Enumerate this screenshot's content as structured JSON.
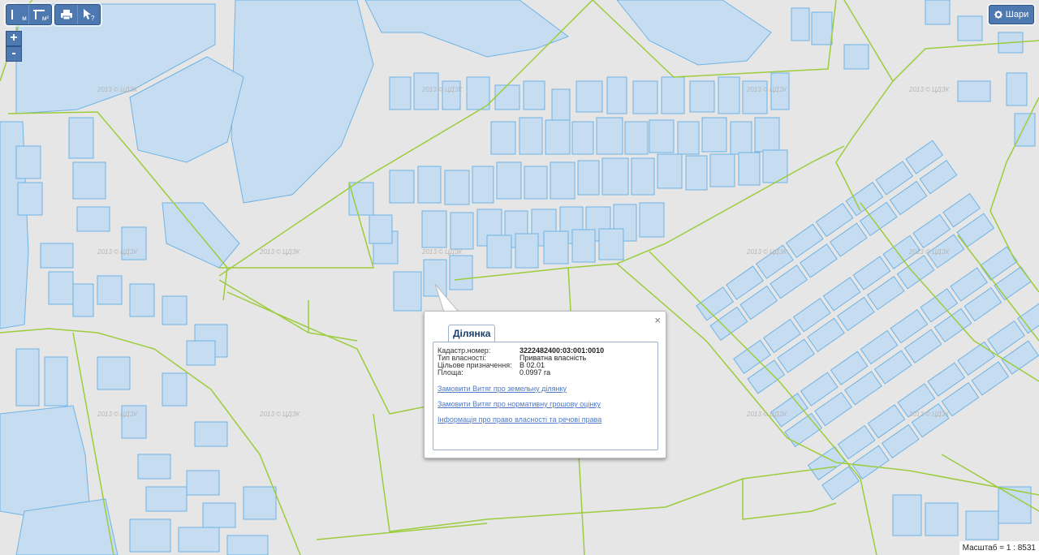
{
  "toolbar": {
    "measure_length_label": "м",
    "measure_area_label": "м²",
    "print_icon": "printer-icon",
    "info_icon": "identify-icon"
  },
  "zoom": {
    "in_label": "+",
    "out_label": "-"
  },
  "layers_button": {
    "label": "Шари",
    "icon": "gear-icon"
  },
  "watermark": "2013 © ЦДЗК",
  "popup": {
    "tab_label": "Ділянка",
    "close_symbol": "×",
    "fields": [
      {
        "label": "Кадастр.номер:",
        "value": "3222482400:03:001:0010"
      },
      {
        "label": "Тип власності:",
        "value": "Приватна власність"
      },
      {
        "label": "Цільове призначення:",
        "value": "В 02.01"
      },
      {
        "label": "Площа:",
        "value": "0.0997 га"
      }
    ],
    "links": [
      "Замовити Витяг про земельну ділянку",
      "Замовити Витяг про нормативну грошову оцінку",
      "Інформація про право власності та речові права"
    ]
  },
  "scale": {
    "label": "Масштаб = 1 : 8531"
  },
  "colors": {
    "background": "#e6e6e6",
    "parcel_fill": "#c6ddf1",
    "parcel_stroke": "#6fb3e4",
    "boundary": "#9ccc3c",
    "button": "#4d79b0",
    "link": "#4d79c7"
  }
}
